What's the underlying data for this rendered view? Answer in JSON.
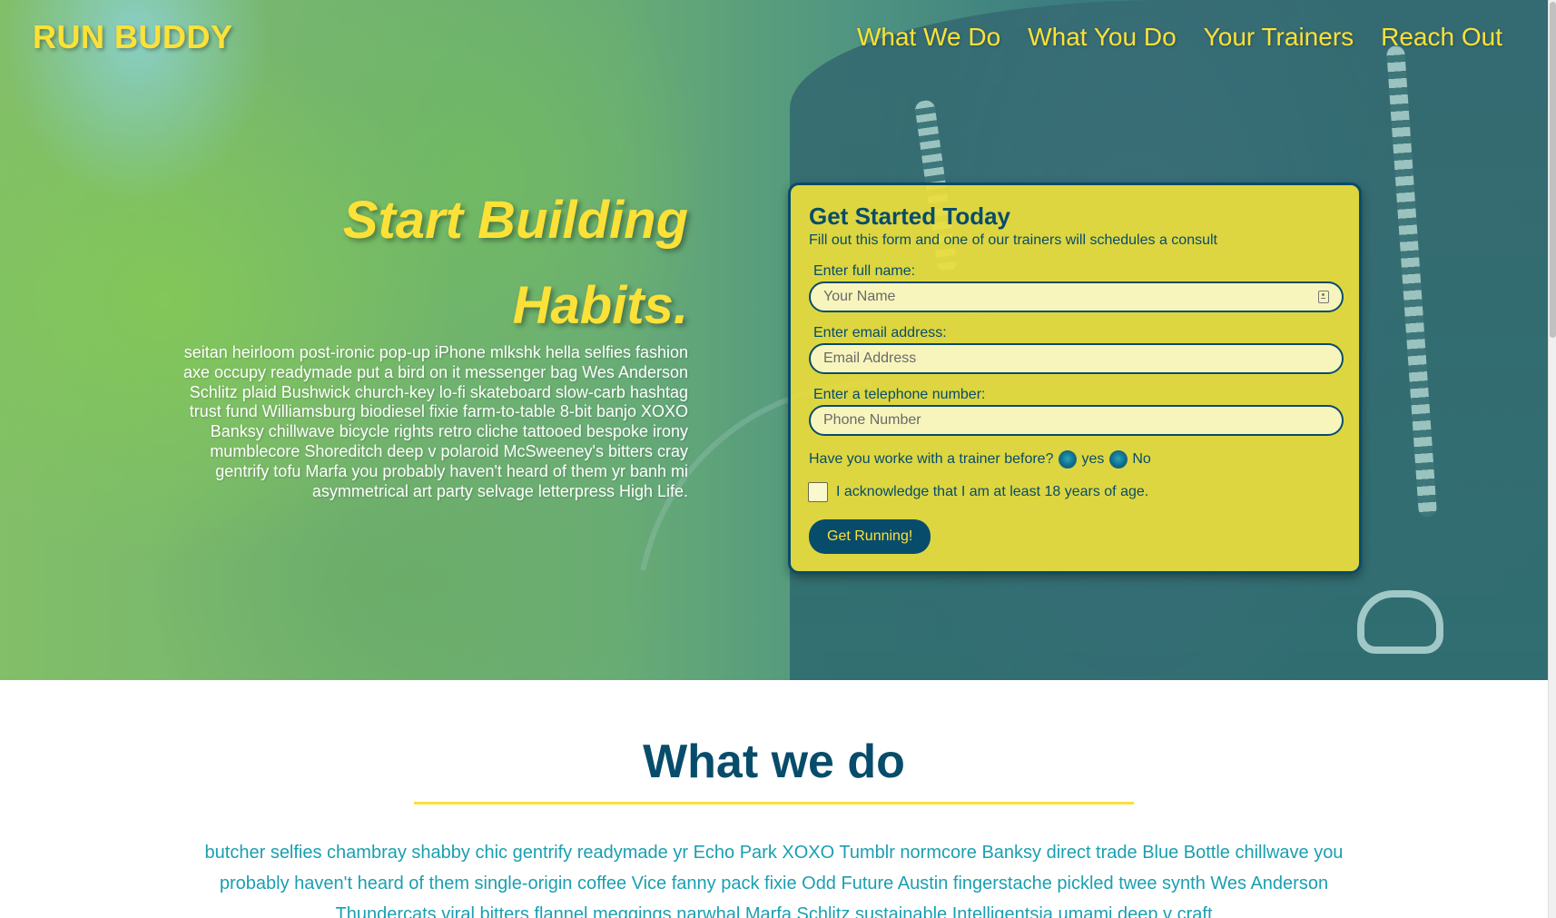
{
  "header": {
    "logo": "RUN BUDDY",
    "nav": [
      "What We Do",
      "What You Do",
      "Your Trainers",
      "Reach Out"
    ]
  },
  "hero": {
    "title_line1": "Start Building",
    "title_line2": "Habits.",
    "paragraph": "seitan heirloom post-ironic pop-up iPhone mlkshk hella selfies fashion axe occupy readymade put a bird on it messenger bag Wes Anderson Schlitz plaid Bushwick church-key lo-fi skateboard slow-carb hashtag trust fund Williamsburg biodiesel fixie farm-to-table 8-bit banjo XOXO Banksy chillwave bicycle rights retro cliche tattooed bespoke irony mumblecore Shoreditch deep v polaroid McSweeney's bitters cray gentrify tofu Marfa you probably haven't heard of them yr banh mi asymmetrical art party selvage letterpress High Life."
  },
  "form": {
    "title": "Get Started Today",
    "subtitle": "Fill out this form and one of our trainers will schedules a consult",
    "name_label": "Enter full name:",
    "name_placeholder": "Your Name",
    "email_label": "Enter email address:",
    "email_placeholder": "Email Address",
    "phone_label": "Enter a telephone number:",
    "phone_placeholder": "Phone Number",
    "trainer_question": "Have you worke with a trainer before?",
    "option_yes": "yes",
    "option_no": "No",
    "acknowledge": "I acknowledge that I am at least 18 years of age.",
    "submit": "Get Running!"
  },
  "what_we_do": {
    "title": "What we do",
    "paragraph": "butcher selfies chambray shabby chic gentrify readymade yr Echo Park XOXO Tumblr normcore Banksy direct trade Blue Bottle chillwave you probably haven't heard of them single-origin coffee Vice fanny pack fixie Odd Future Austin fingerstache pickled twee synth Wes Anderson Thundercats viral bitters flannel meggings narwhal Marfa Schlitz sustainable Intelligentsia umami deep v craft"
  },
  "colors": {
    "primary": "#074c6b",
    "accent": "#fce138",
    "teal_text": "#1a9fb0"
  }
}
